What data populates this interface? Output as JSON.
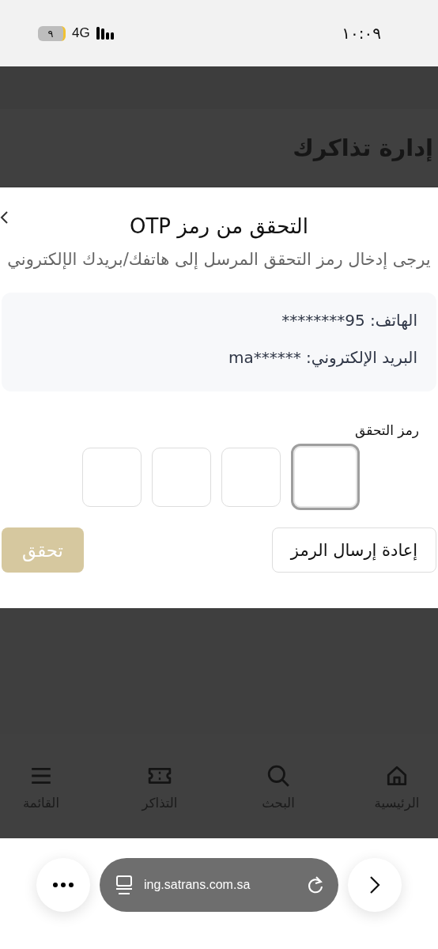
{
  "status_bar": {
    "time": "١٠:٠٩",
    "battery": "٩",
    "network": "4G"
  },
  "page": {
    "title": "إدارة تذاكرك"
  },
  "dialog": {
    "title": "التحقق من رمز OTP",
    "subtitle": "يرجى إدخال رمز التحقق المرسل إلى هاتفك/بريدك الإلكتروني",
    "contact": [
      {
        "label": "الهاتف:",
        "value": "********95"
      },
      {
        "label": "البريد الإلكتروني:",
        "value": "ma******"
      }
    ],
    "code_label": "رمز التحقق",
    "code_boxes": [
      {
        "focused": true
      },
      {
        "focused": false
      },
      {
        "focused": false
      },
      {
        "focused": false
      }
    ],
    "buttons": [
      {
        "kind": "secondary",
        "label": "إعادة إرسال الرمز"
      },
      {
        "kind": "primary",
        "label": "تحقق"
      }
    ]
  },
  "bottom_nav": [
    {
      "kind": "home",
      "label": "الرئيسية"
    },
    {
      "kind": "search",
      "label": "البحث"
    },
    {
      "kind": "tickets",
      "label": "التذاكر"
    },
    {
      "kind": "menu",
      "label": "القائمة"
    }
  ],
  "browser": {
    "url": "ing.satrans.com.sa"
  }
}
